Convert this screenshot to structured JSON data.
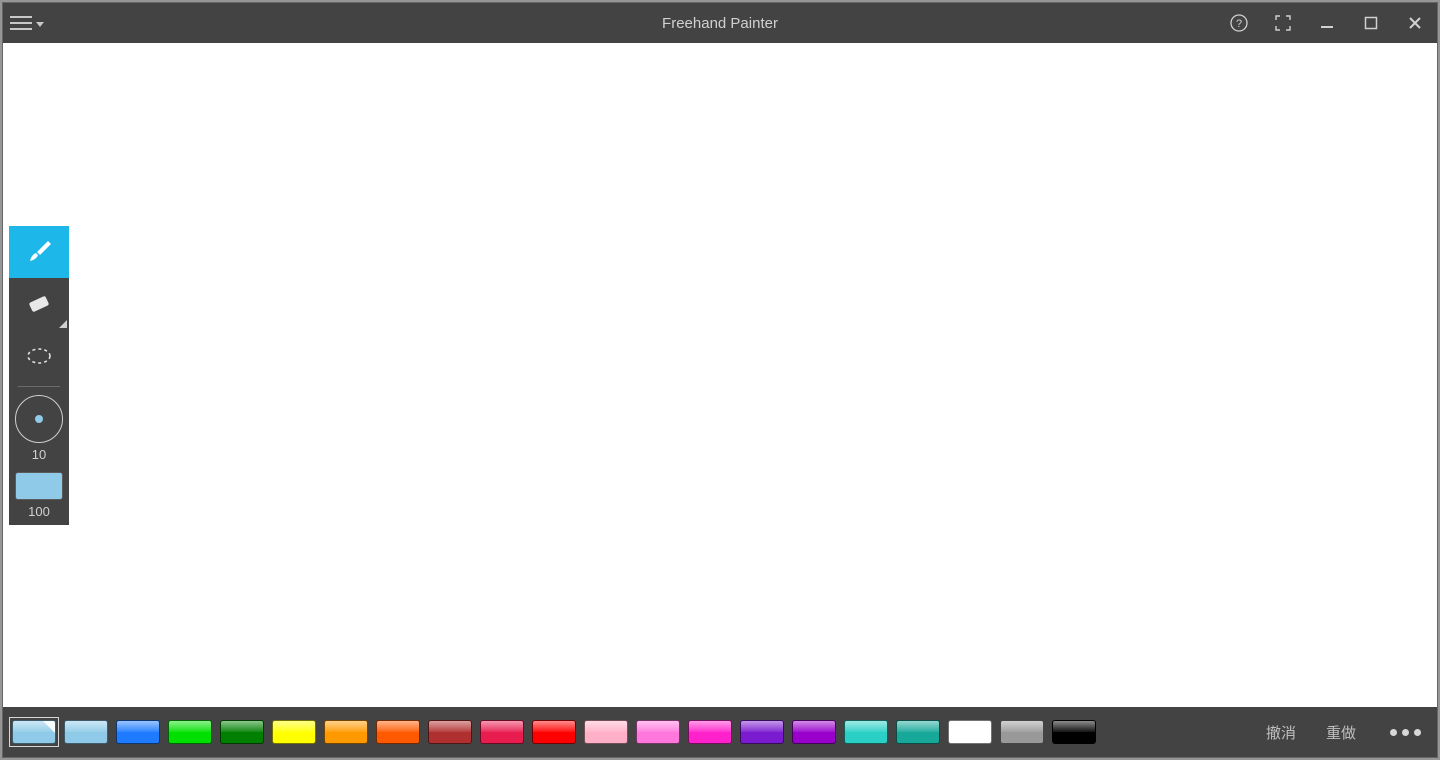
{
  "titlebar": {
    "title": "Freehand Painter"
  },
  "tools": {
    "brush_active": true,
    "size_value": "10",
    "opacity_value": "100",
    "current_color": "#8fcbe8"
  },
  "palette": {
    "selected_index": 0,
    "colors": [
      {
        "hex": "#8fcbe8",
        "fold": true
      },
      {
        "hex": "#8fcbe8",
        "fold": false
      },
      {
        "hex": "#1e7bff",
        "fold": false
      },
      {
        "hex": "#00e000",
        "fold": false
      },
      {
        "hex": "#008000",
        "fold": false
      },
      {
        "hex": "#ffff00",
        "fold": false
      },
      {
        "hex": "#ff9900",
        "fold": false
      },
      {
        "hex": "#ff5a00",
        "fold": false
      },
      {
        "hex": "#b03030",
        "fold": false
      },
      {
        "hex": "#e81c4f",
        "fold": false
      },
      {
        "hex": "#ff0000",
        "fold": false
      },
      {
        "hex": "#ffb0c8",
        "fold": false
      },
      {
        "hex": "#ff77dd",
        "fold": false
      },
      {
        "hex": "#ff22cc",
        "fold": false
      },
      {
        "hex": "#7a1bd0",
        "fold": false
      },
      {
        "hex": "#9900cc",
        "fold": false
      },
      {
        "hex": "#2ad0c6",
        "fold": false
      },
      {
        "hex": "#18a89a",
        "fold": false
      },
      {
        "hex": "#ffffff",
        "fold": false
      },
      {
        "hex": "#999999",
        "fold": false
      },
      {
        "hex": "#000000",
        "fold": false
      }
    ]
  },
  "bottombar": {
    "undo_label": "撤消",
    "redo_label": "重做"
  }
}
